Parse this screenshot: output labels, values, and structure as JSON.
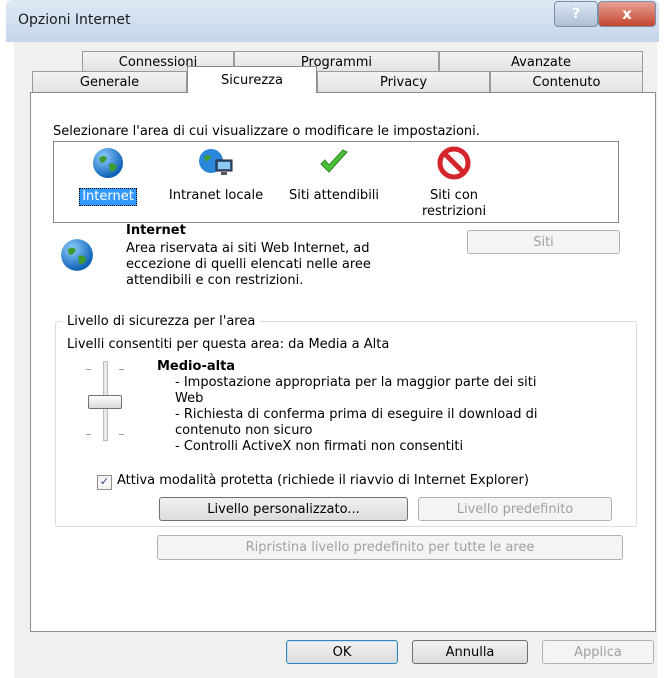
{
  "window": {
    "title": "Opzioni Internet",
    "help_label": "?",
    "close_label": "x"
  },
  "tabs": {
    "row1": [
      "Connessioni",
      "Programmi",
      "Avanzate"
    ],
    "row2": [
      "Generale",
      "Sicurezza",
      "Privacy",
      "Contenuto"
    ],
    "active": "Sicurezza"
  },
  "zones": {
    "prompt": "Selezionare l'area di cui visualizzare o modificare le impostazioni.",
    "items": [
      {
        "label": "Internet",
        "icon": "globe-icon",
        "selected": true
      },
      {
        "label": "Intranet locale",
        "icon": "intranet-icon"
      },
      {
        "label": "Siti attendibili",
        "icon": "checkmark-icon"
      },
      {
        "label": "Siti con restrizioni",
        "icon": "restricted-icon"
      }
    ]
  },
  "zone_info": {
    "name": "Internet",
    "description_lines": [
      "Area riservata ai siti Web Internet, ad",
      "eccezione di quelli elencati nelle aree",
      "attendibili e con restrizioni."
    ],
    "sites_button": "Siti"
  },
  "security_level": {
    "group_title": "Livello di sicurezza per l'area",
    "allowed": "Livelli consentiti per questa area: da Media a Alta",
    "level_name": "Medio-alta",
    "details": [
      "- Impostazione appropriata per la maggior parte dei siti",
      "Web",
      "- Richiesta di conferma prima di eseguire il download di",
      "contenuto non sicuro",
      "- Controlli ActiveX non firmati non consentiti"
    ],
    "protected_mode_label": "Attiva modalità protetta (richiede il riavvio di Internet Explorer)",
    "protected_mode_checked": true,
    "custom_level_button": "Livello personalizzato...",
    "default_level_button": "Livello predefinito",
    "reset_all_button": "Ripristina livello predefinito per tutte le aree"
  },
  "footer": {
    "ok": "OK",
    "cancel": "Annulla",
    "apply": "Applica"
  },
  "colors": {
    "selection": "#3399ff",
    "window_bg": "#f0f0f0",
    "close_red": "#c4452f"
  }
}
